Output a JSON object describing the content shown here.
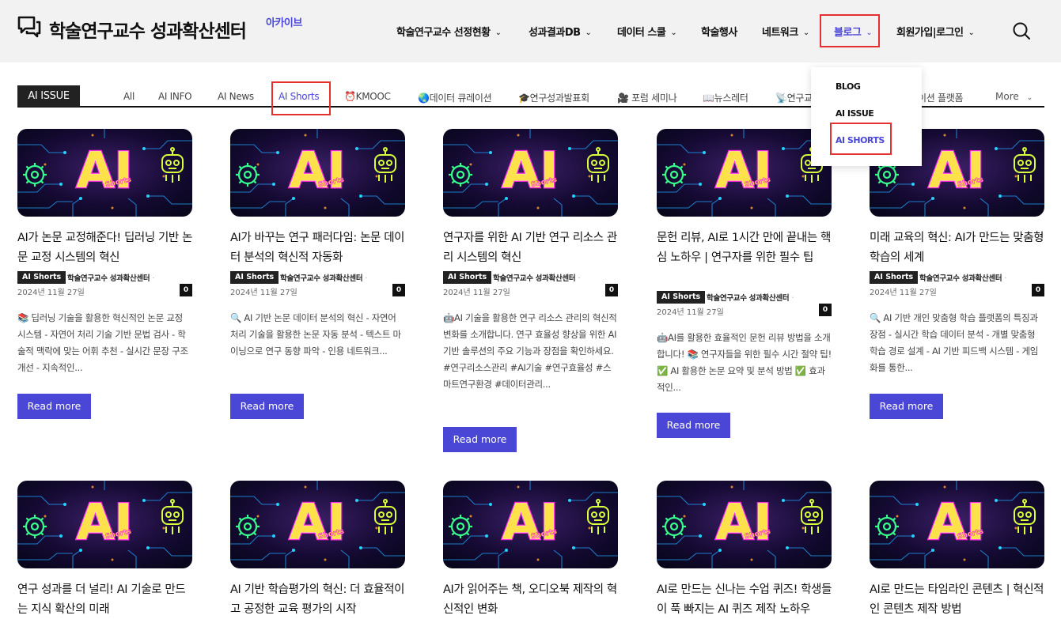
{
  "header": {
    "site_title": "학술연구교수 성과확산센터",
    "site_tag": "아카이브",
    "nav": [
      {
        "label": "학술연구교수 선정현황",
        "chev": "⌄"
      },
      {
        "label": "성과결과DB",
        "chev": "⌄"
      },
      {
        "label": "데이터 스쿨",
        "chev": "⌄"
      },
      {
        "label": "학술행사",
        "chev": ""
      },
      {
        "label": "네트워크",
        "chev": "⌄"
      },
      {
        "label": "블로그",
        "chev": "⌄"
      },
      {
        "label": "회원가입|로그인",
        "chev": "⌄"
      }
    ]
  },
  "dropdown": {
    "items": [
      "BLOG",
      "AI ISSUE",
      "AI SHORTS"
    ]
  },
  "filter_bar": {
    "badge": "AI ISSUE",
    "tabs": [
      "All",
      "AI INFO",
      "AI News",
      "AI Shorts",
      "⏰KMOOC",
      "🌏데이터 큐레이션",
      "🎓연구성과발표회",
      "🎥 포럼 세미나",
      "📖뉴스레터",
      "📡연구교",
      "이션 플랫폼"
    ],
    "more": "More",
    "more_chev": "⌄"
  },
  "colors": {
    "accent": "#4b47d6",
    "highlight": "#e53030",
    "dark": "#222222"
  },
  "cards": [
    {
      "title": "AI가 논문 교정해준다! 딥러닝 기반 논문 교정 시스템의 혁신",
      "category": "AI Shorts",
      "author": "학술연구교수 성과확산센터",
      "dot": "·",
      "date": "2024년 11월 27일",
      "comments": "0",
      "excerpt": "📚 딥러닝 기술을 활용한 혁신적인 논문 교정 시스템 - 자연어 처리 기술 기반 문법 검사 - 학술적 맥락에 맞는 어휘 추천 - 실시간 문장 구조 개선 - 지속적인...",
      "read_more": "Read more"
    },
    {
      "title": "AI가 바꾸는 연구 패러다임: 논문 데이터 분석의 혁신적 자동화",
      "category": "AI Shorts",
      "author": "학술연구교수 성과확산센터",
      "dot": "·",
      "date": "2024년 11월 27일",
      "comments": "0",
      "excerpt": "🔍 AI 기반 논문 데이터 분석의 혁신 - 자연어 처리 기술을 활용한 논문 자동 분석 - 텍스트 마이닝으로 연구 동향 파악 - 인용 네트워크...",
      "read_more": "Read more"
    },
    {
      "title": "연구자를 위한 AI 기반 연구 리소스 관리 시스템의 혁신",
      "category": "AI Shorts",
      "author": "학술연구교수 성과확산센터",
      "dot": "·",
      "date": "2024년 11월 27일",
      "comments": "0",
      "excerpt": "🤖AI 기술을 활용한 연구 리소스 관리의 혁신적 변화를 소개합니다. 연구 효율성 향상을 위한 AI 기반 솔루션의 주요 기능과 장점을 확인하세요. #연구리소스관리 #AI기술 #연구효율성 #스마트연구환경 #데이터관리...",
      "read_more": "Read more"
    },
    {
      "title": "문헌 리뷰, AI로 1시간 만에 끝내는 핵심 노하우 | 연구자를 위한 필수 팁",
      "category": "AI Shorts",
      "author": "학술연구교수 성과확산센터",
      "dot": "·",
      "date": "2024년 11월 27일",
      "comments": "0",
      "excerpt": "🤖AI를 활용한 효율적인 문헌 리뷰 방법을 소개합니다! 📚 연구자들을 위한 필수 시간 절약 팁! ✅ AI 활용한 논문 요약 및 분석 방법 ✅ 효과적인...",
      "read_more": "Read more"
    },
    {
      "title": "미래 교육의 혁신: AI가 만드는 맞춤형 학습의 세계",
      "category": "AI Shorts",
      "author": "학술연구교수 성과확산센터",
      "dot": "·",
      "date": "2024년 11월 27일",
      "comments": "0",
      "excerpt": "🔍 AI 기반 개인 맞춤형 학습 플랫폼의 특징과 장점 - 실시간 학습 데이터 분석 - 개별 맞춤형 학습 경로 설계 - AI 기반 피드백 시스템 - 게임화를 통한...",
      "read_more": "Read more"
    },
    {
      "title": "연구 성과를 더 널리! AI 기술로 만드는 지식 확산의 미래"
    },
    {
      "title": "AI 기반 학습평가의 혁신: 더 효율적이고 공정한 교육 평가의 시작"
    },
    {
      "title": "AI가 읽어주는 책, 오디오북 제작의 혁신적인 변화"
    },
    {
      "title": "AI로 만드는 신나는 수업 퀴즈! 학생들이 푹 빠지는 AI 퀴즈 제작 노하우"
    },
    {
      "title": "AI로 만드는 타임라인 콘텐츠 | 혁신적인 콘텐츠 제작 방법"
    }
  ],
  "thumbnail": {
    "main_text": "AI",
    "sub_text": "Shorts",
    "neon_colors": [
      "#ff2bd6",
      "#ffe14a",
      "#37ff8b",
      "#22d3ff"
    ]
  }
}
